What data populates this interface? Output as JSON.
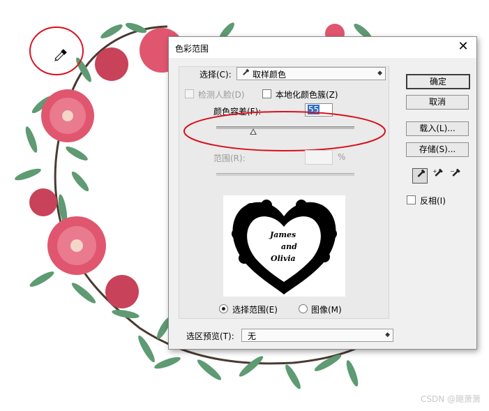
{
  "dialog": {
    "title": "色彩范围",
    "close_glyph": "✕",
    "select_label": "选择(C):",
    "select_value": "取样颜色",
    "select_icon": "eyedropper-icon",
    "detect_faces_label": "检测人脸(D)",
    "localized_clusters_label": "本地化颜色簇(Z)",
    "fuzziness_label": "颜色容差(F):",
    "fuzziness_value": "55",
    "range_label": "范围(R):",
    "range_value": "",
    "range_unit": "%",
    "buttons": {
      "ok": "确定",
      "cancel": "取消",
      "load": "载入(L)...",
      "save": "存储(S)..."
    },
    "tools": [
      "eyedropper-icon",
      "eyedropper-plus-icon",
      "eyedropper-minus-icon"
    ],
    "invert_label": "反相(I)",
    "preview_text": [
      "James",
      "and",
      "Olivia"
    ],
    "radio_selection_label": "选择范围(E)",
    "radio_image_label": "图像(M)",
    "selection_preview_label": "选区预览(T):",
    "selection_preview_value": "无"
  },
  "watermark": "CSDN @飓萧萧",
  "colors": {
    "annotation_red": "#d8101c",
    "petal_pink": "#e0566f",
    "leaf_green": "#5e9a72",
    "selection_blue": "#2f6fc7"
  }
}
